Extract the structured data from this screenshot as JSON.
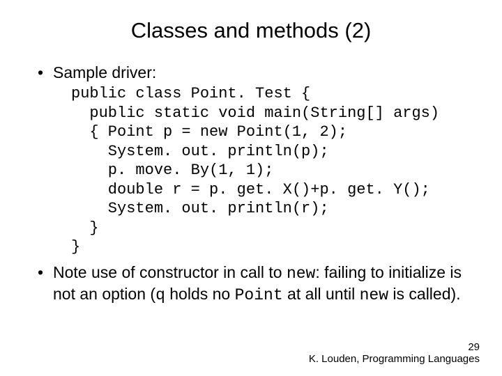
{
  "title": "Classes and methods (2)",
  "bullet1": "Sample driver:",
  "code": "public class Point. Test {\n  public static void main(String[] args)\n  { Point p = new Point(1, 2);\n    System. out. println(p);\n    p. move. By(1, 1);\n    double r = p. get. X()+p. get. Y();\n    System. out. println(r);\n  }\n}",
  "note": {
    "part1": "Note use of constructor in call to ",
    "kw1": "new",
    "part2": ": failing to initialize is not an option (",
    "kw2": "q",
    "part3": " holds no ",
    "kw3": "Point",
    "part4": " at all until ",
    "kw4": "new",
    "part5": " is called)."
  },
  "footer": {
    "page": "29",
    "author": "K. Louden, Programming Languages"
  }
}
